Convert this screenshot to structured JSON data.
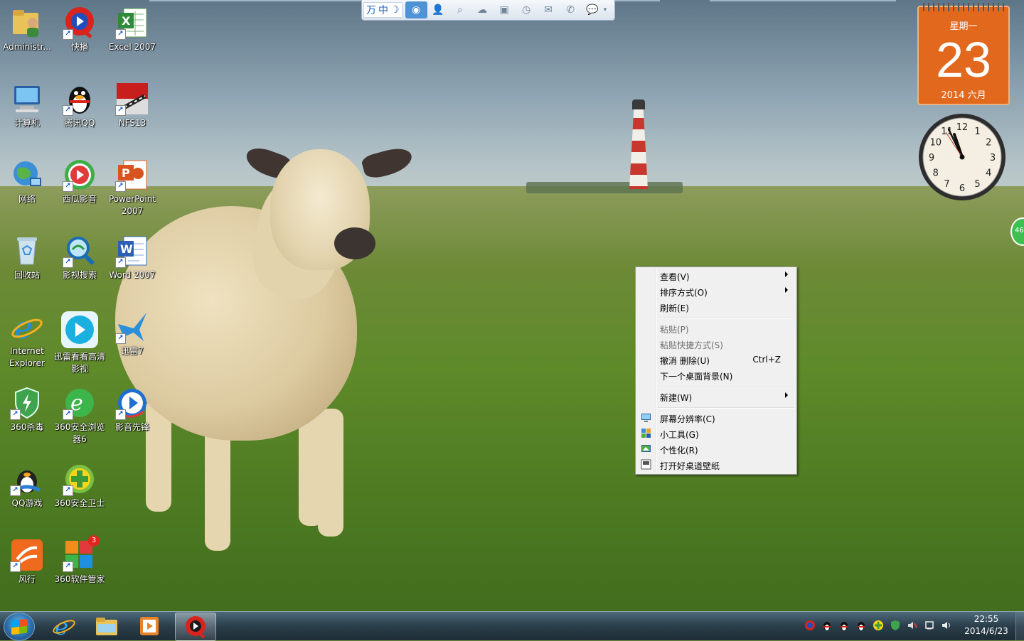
{
  "desktop": {
    "icons": [
      {
        "label": "Administr..."
      },
      {
        "label": "快播"
      },
      {
        "label": "Excel 2007"
      },
      {
        "label": "计算机"
      },
      {
        "label": "腾讯QQ"
      },
      {
        "label": "NFS13"
      },
      {
        "label": "网络"
      },
      {
        "label": "西瓜影音"
      },
      {
        "label": "PowerPoint 2007"
      },
      {
        "label": "回收站"
      },
      {
        "label": "影视搜索"
      },
      {
        "label": "Word 2007"
      },
      {
        "label": "Internet Explorer"
      },
      {
        "label": "迅雷看看高清影视"
      },
      {
        "label": "迅雷7"
      },
      {
        "label": "360杀毒"
      },
      {
        "label": "360安全浏览器6"
      },
      {
        "label": "影音先锋"
      },
      {
        "label": "QQ游戏"
      },
      {
        "label": "360安全卫士"
      },
      {
        "label": "风行"
      },
      {
        "label": "360软件管家"
      }
    ],
    "badge_360_software": "3"
  },
  "topbar": {
    "ime_mode": "中",
    "buttons": [
      "qq-logo-icon",
      "contacts-icon",
      "search-icon",
      "cloud-icon",
      "photo-icon",
      "clock-icon",
      "mail-icon",
      "phone-icon",
      "chat-icon"
    ]
  },
  "calendar": {
    "weekday": "星期一",
    "day": "23",
    "year_month": "2014 六月"
  },
  "clock": {
    "numerals": [
      "12",
      "1",
      "2",
      "3",
      "4",
      "5",
      "6",
      "7",
      "8",
      "9",
      "10",
      "11"
    ]
  },
  "side_widget": "46",
  "context_menu": {
    "items": [
      {
        "label": "查看(V)"
      },
      {
        "label": "排序方式(O)"
      },
      {
        "label": "刷新(E)"
      },
      {
        "label": "粘贴(P)"
      },
      {
        "label": "粘贴快捷方式(S)"
      },
      {
        "label": "撤消 删除(U)",
        "shortcut": "Ctrl+Z"
      },
      {
        "label": "下一个桌面背景(N)"
      },
      {
        "label": "新建(W)"
      },
      {
        "label": "屏幕分辨率(C)"
      },
      {
        "label": "小工具(G)"
      },
      {
        "label": "个性化(R)"
      },
      {
        "label": "打开好桌道壁纸"
      }
    ]
  },
  "taskbar": {
    "time": "22:55",
    "date": "2014/6/23"
  },
  "colors": {
    "calendar_orange": "#e2681e",
    "menu_bg": "#f0f0f0",
    "taskbar": "#2a3e4b"
  }
}
